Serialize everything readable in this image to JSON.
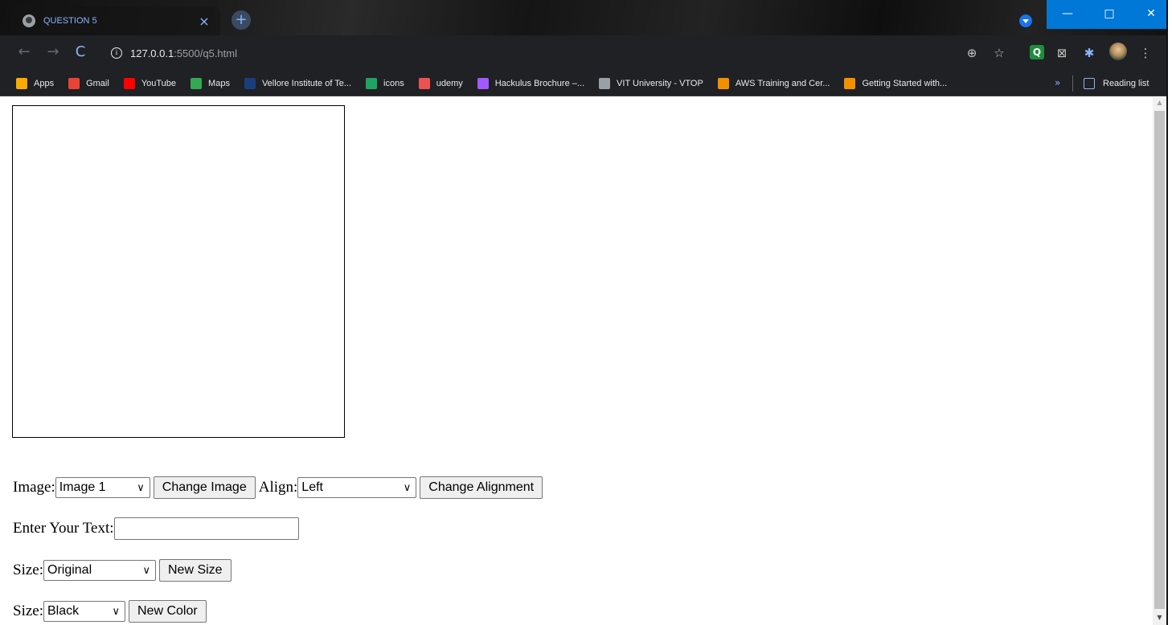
{
  "tab": {
    "title": "QUESTION 5",
    "close": "×",
    "new_tab": "+"
  },
  "window_controls": {
    "minimize": "—",
    "maximize": "□",
    "close": "✕"
  },
  "toolbar": {
    "back": "←",
    "forward": "→",
    "reload": "C",
    "info_icon": "i",
    "url_host": "127.0.0.1",
    "url_path": ":5500/q5.html",
    "zoom_icon": "⊕",
    "star_icon": "☆",
    "ext_q": "Q",
    "ext_x": "⊠",
    "puzzle_icon": "✱",
    "menu_icon": "⋮"
  },
  "bookmarks": {
    "items": [
      {
        "label": "Apps",
        "icon": "apps-grid-icon",
        "color": "#f9ab00"
      },
      {
        "label": "Gmail",
        "icon": "gmail-icon",
        "color": "#ea4335"
      },
      {
        "label": "YouTube",
        "icon": "youtube-icon",
        "color": "#ff0000"
      },
      {
        "label": "Maps",
        "icon": "maps-pin-icon",
        "color": "#34a853"
      },
      {
        "label": "Vellore Institute of Te...",
        "icon": "vit-logo-icon",
        "color": "#1a3d7c"
      },
      {
        "label": "icons",
        "icon": "icons-app-icon",
        "color": "#1ea362"
      },
      {
        "label": "udemy",
        "icon": "udemy-icon",
        "color": "#ec5252"
      },
      {
        "label": "Hackulus Brochure –...",
        "icon": "figma-icon",
        "color": "#a259ff"
      },
      {
        "label": "VIT University - VTOP",
        "icon": "vtop-icon",
        "color": "#9aa0a6"
      },
      {
        "label": "AWS Training and Cer...",
        "icon": "aws-cube-icon",
        "color": "#f29100"
      },
      {
        "label": "Getting Started with...",
        "icon": "aws-cube-icon",
        "color": "#f29100"
      }
    ],
    "more": "»",
    "reading_list": "Reading list"
  },
  "form": {
    "image_label": "Image:",
    "image_select": "Image 1",
    "change_image": "Change Image",
    "align_label": "Align:",
    "align_select": "Left",
    "change_alignment": "Change Alignment",
    "text_label": "Enter Your Text:",
    "text_value": "",
    "size_label": "Size:",
    "size_select": "Original",
    "new_size": "New Size",
    "color_label": "Size:",
    "color_select": "Black",
    "new_color": "New Color"
  },
  "colors": {
    "accent": "#8ab4f8",
    "chrome_bg": "#202124",
    "win_blue": "#0078d7"
  }
}
